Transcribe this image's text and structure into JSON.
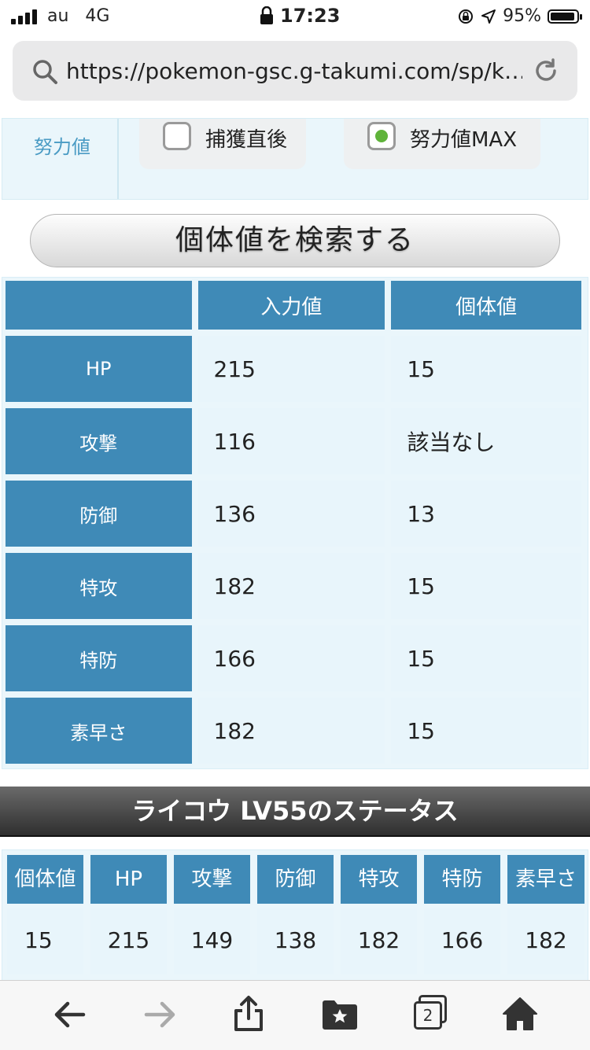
{
  "status_bar": {
    "carrier": "au",
    "network": "4G",
    "time": "17:23",
    "battery": "95%",
    "battery_level": 0.95
  },
  "browser": {
    "url": "https://pokemon-gsc.g-takumi.com/sp/k…",
    "tab_count": "2"
  },
  "effort": {
    "label": "努力値",
    "options": [
      {
        "label": "捕獲直後",
        "checked": false
      },
      {
        "label": "努力値MAX",
        "checked": true
      }
    ]
  },
  "search_button": "個体値を検索する",
  "iv_table": {
    "headers": [
      "入力値",
      "個体値"
    ],
    "rows": [
      {
        "stat": "HP",
        "input": "215",
        "iv": "15"
      },
      {
        "stat": "攻撃",
        "input": "116",
        "iv": "該当なし"
      },
      {
        "stat": "防御",
        "input": "136",
        "iv": "13"
      },
      {
        "stat": "特攻",
        "input": "182",
        "iv": "15"
      },
      {
        "stat": "特防",
        "input": "166",
        "iv": "15"
      },
      {
        "stat": "素早さ",
        "input": "182",
        "iv": "15"
      }
    ]
  },
  "status_section": {
    "title": "ライコウ LV55のステータス",
    "headers": [
      "個体値",
      "HP",
      "攻撃",
      "防御",
      "特攻",
      "特防",
      "素早さ"
    ],
    "values": [
      "15",
      "215",
      "149",
      "138",
      "182",
      "166",
      "182"
    ]
  },
  "colors": {
    "header_blue": "#3f8ab7",
    "cell_light": "#e8f5fb",
    "checked_green": "#5fb33a"
  },
  "icons": [
    "signal-icon",
    "lock-icon",
    "orientation-lock-icon",
    "location-icon",
    "battery-icon",
    "search-icon",
    "reload-icon",
    "back-icon",
    "forward-icon",
    "share-icon",
    "bookmarks-icon",
    "tabs-icon",
    "home-icon"
  ]
}
